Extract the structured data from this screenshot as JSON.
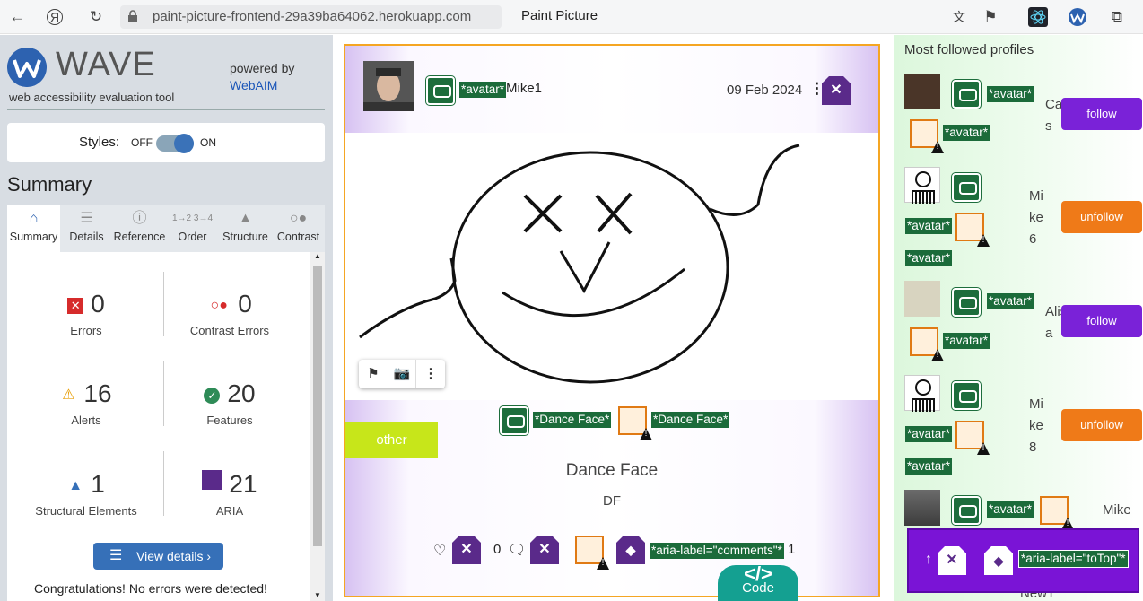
{
  "browser": {
    "url": "paint-picture-frontend-29a39ba64062.herokuapp.com",
    "page_title": "Paint Picture",
    "icons": [
      "back-icon",
      "yandex-icon",
      "reload-icon",
      "lock-icon",
      "translate-icon",
      "bookmark-icon",
      "react-devtools-icon",
      "wave-extension-icon",
      "collections-icon"
    ]
  },
  "wave": {
    "logo_text": "WAVE",
    "tagline": "web accessibility evaluation tool",
    "powered_by": "powered by",
    "webaim": "WebAIM",
    "styles_label": "Styles:",
    "styles_off": "OFF",
    "styles_on": "ON",
    "styles_state": "on",
    "summary_heading": "Summary",
    "tabs": [
      {
        "label": "Summary",
        "icon": "home-icon",
        "selected": true
      },
      {
        "label": "Details",
        "icon": "list-icon",
        "selected": false
      },
      {
        "label": "Reference",
        "icon": "info-icon",
        "selected": false
      },
      {
        "label": "Order",
        "icon": "order-icon",
        "selected": false
      },
      {
        "label": "Structure",
        "icon": "structure-icon",
        "selected": false
      },
      {
        "label": "Contrast",
        "icon": "contrast-icon",
        "selected": false
      }
    ],
    "stats": {
      "errors": {
        "value": "0",
        "label": "Errors",
        "color": "#d62b2b"
      },
      "contrast": {
        "value": "0",
        "label": "Contrast Errors",
        "color": "#d62b2b"
      },
      "alerts": {
        "value": "16",
        "label": "Alerts",
        "color": "#e8a00c"
      },
      "features": {
        "value": "20",
        "label": "Features",
        "color": "#2e8b57"
      },
      "structural": {
        "value": "1",
        "label": "Structural Elements",
        "color": "#3670b8"
      },
      "aria": {
        "value": "21",
        "label": "ARIA",
        "color": "#5a2a8a"
      }
    },
    "view_details": "View details ›",
    "congrats": "Congratulations! No errors were detected!"
  },
  "post": {
    "avatar_tag": "*avatar*",
    "username": "Mike1",
    "date": "09 Feb 2024",
    "image_tag_1": "*Dance Face*",
    "image_tag_2": "*Dance Face*",
    "category": "other",
    "title": "Dance Face",
    "description": "DF",
    "likes_count": "0",
    "comments_label": "*aria-label=\"comments\"*",
    "comments_count": "1"
  },
  "code_button": "Code",
  "sidebar": {
    "heading": "Most followed profiles",
    "profiles": [
      {
        "name": "Cats",
        "tag1": "*avatar*",
        "tag2": "*avatar*",
        "button": "follow",
        "button_type": "follow"
      },
      {
        "name": "Mike6",
        "tag1": "*avatar*",
        "tag2": "*avatar*",
        "button": "unfollow",
        "button_type": "unfollow"
      },
      {
        "name": "Alisa",
        "tag1": "*avatar*",
        "tag2": "*avatar*",
        "button": "follow",
        "button_type": "follow"
      },
      {
        "name": "Mike8",
        "tag1": "*avatar*",
        "tag2": "*avatar*",
        "button": "unfollow",
        "button_type": "unfollow"
      },
      {
        "name": "Mike",
        "tag1": "*avatar*"
      },
      {
        "name": "NewT"
      }
    ],
    "totop_label": "*aria-label=\"toTop\"*"
  }
}
